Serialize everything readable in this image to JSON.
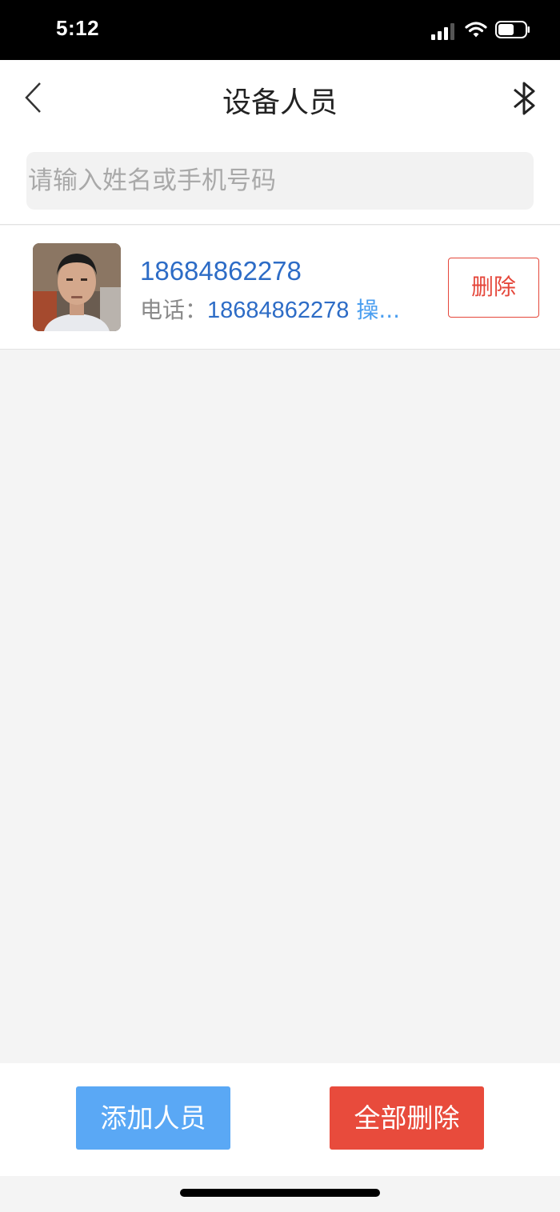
{
  "status_bar": {
    "time": "5:12"
  },
  "nav": {
    "title": "设备人员"
  },
  "search": {
    "placeholder": "请输入姓名或手机号码"
  },
  "people": [
    {
      "name": "18684862278",
      "phone_label": "电话：",
      "phone": "18684862278",
      "extra": "操...",
      "delete_label": "删除"
    }
  ],
  "footer": {
    "add_label": "添加人员",
    "delete_all_label": "全部删除"
  },
  "colors": {
    "accent_blue": "#2d6cc6",
    "button_blue": "#5aa8f5",
    "danger_red": "#e84b3c"
  }
}
